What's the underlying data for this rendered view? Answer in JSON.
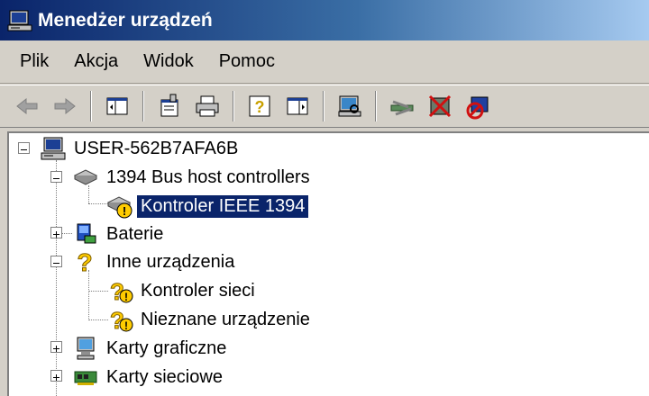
{
  "window": {
    "title": "Menedżer urządzeń"
  },
  "menu": [
    "Plik",
    "Akcja",
    "Widok",
    "Pomoc"
  ],
  "toolbar": {
    "buttons": [
      {
        "icon": "back-arrow-icon"
      },
      {
        "icon": "forward-arrow-icon"
      },
      {
        "icon": "show-hide-console-tree-icon"
      },
      {
        "icon": "properties-icon"
      },
      {
        "icon": "print-icon"
      },
      {
        "icon": "help-icon"
      },
      {
        "icon": "show-hide-action-pane-icon"
      },
      {
        "icon": "scan-hardware-icon"
      },
      {
        "icon": "update-driver-icon"
      },
      {
        "icon": "uninstall-icon"
      },
      {
        "icon": "disable-device-icon"
      }
    ]
  },
  "tree": {
    "root": "USER-562B7AFA6B",
    "nodes": [
      {
        "label": "1394 Bus host controllers",
        "icon": "bus-controller-icon",
        "expanded": true
      },
      {
        "label": "Kontroler IEEE 1394",
        "icon": "warning-device-icon",
        "selected": true
      },
      {
        "label": "Baterie",
        "icon": "battery-icon",
        "expanded": false
      },
      {
        "label": "Inne urządzenia",
        "icon": "unknown-device-icon",
        "expanded": true
      },
      {
        "label": "Kontroler sieci",
        "icon": "unknown-device-icon"
      },
      {
        "label": "Nieznane urządzenie",
        "icon": "unknown-device-icon"
      },
      {
        "label": "Karty graficzne",
        "icon": "display-adapter-icon",
        "expanded": false
      },
      {
        "label": "Karty sieciowe",
        "icon": "network-adapter-icon",
        "expanded": false
      }
    ]
  },
  "colors": {
    "title_start": "#0a246a",
    "title_end": "#a6caf0",
    "selection": "#0a246a",
    "face": "#d4d0c8",
    "warning": "#ffcc00"
  }
}
